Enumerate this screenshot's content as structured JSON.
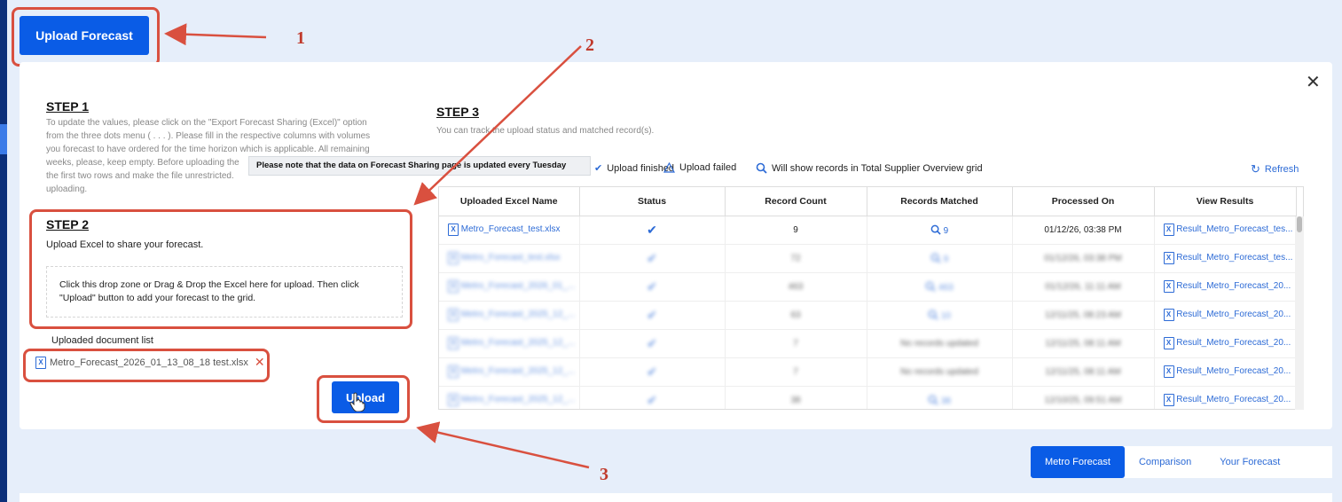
{
  "header": {
    "upload_forecast_label": "Upload Forecast"
  },
  "step1": {
    "title": "STEP 1",
    "text_lines": [
      "To update the values, please click on the \"Export Forecast Sharing (Excel)\" option",
      "from the three dots menu ( . . . ). Please fill in the respective columns with volumes",
      "you forecast to have ordered for the time horizon which is applicable. All remaining",
      "weeks, please, keep empty. Before uploading the",
      "the first two rows and make the file unrestricted.",
      "uploading."
    ]
  },
  "tooltip": {
    "text": "Please note that the data on Forecast Sharing page is updated every Tuesday"
  },
  "step2": {
    "title": "STEP 2",
    "subtitle": "Upload Excel to share your forecast.",
    "dropzone_line1": "Click this drop zone or Drag & Drop the Excel here for upload. Then click",
    "dropzone_line2": "\"Upload\" button to add your forecast to the grid."
  },
  "doclist": {
    "label": "Uploaded document list",
    "file": "Metro_Forecast_2026_01_13_08_18 test.xlsx",
    "remove_icon": "✕"
  },
  "upload_button": {
    "label": "Upload"
  },
  "step3": {
    "title": "STEP 3",
    "subtitle": "You can track the upload status and matched record(s).",
    "legend": {
      "finished": "Upload finished",
      "failed": "Upload failed",
      "records": "Will show records in Total Supplier Overview grid"
    },
    "refresh_label": "Refresh"
  },
  "grid": {
    "columns": [
      "Uploaded Excel Name",
      "Status",
      "Record Count",
      "Records Matched",
      "Processed On",
      "View Results"
    ],
    "rows": [
      {
        "file": "Metro_Forecast_test.xlsx",
        "count": "9",
        "matched": "9",
        "processed": "01/12/26, 03:38 PM",
        "result": "Result_Metro_Forecast_tes...",
        "blurred": false
      },
      {
        "file": "Metro_Forecast_test.xlsx",
        "count": "72",
        "matched": "9",
        "processed": "01/12/26, 03:38 PM",
        "result": "Result_Metro_Forecast_tes...",
        "blurred": true
      },
      {
        "file": "Metro_Forecast_2026_01_...",
        "count": "463",
        "matched": "463",
        "processed": "01/12/26, 11:11 AM",
        "result": "Result_Metro_Forecast_20...",
        "blurred": true
      },
      {
        "file": "Metro_Forecast_2025_12_...",
        "count": "63",
        "matched": "10",
        "processed": "12/11/25, 08:23 AM",
        "result": "Result_Metro_Forecast_20...",
        "blurred": true
      },
      {
        "file": "Metro_Forecast_2025_12_...",
        "count": "7",
        "matched": "No records updated",
        "processed": "12/11/25, 08:11 AM",
        "result": "Result_Metro_Forecast_20...",
        "blurred": true
      },
      {
        "file": "Metro_Forecast_2025_12_...",
        "count": "7",
        "matched": "No records updated",
        "processed": "12/11/25, 08:11 AM",
        "result": "Result_Metro_Forecast_20...",
        "blurred": true
      },
      {
        "file": "Metro_Forecast_2025_12_...",
        "count": "38",
        "matched": "38",
        "processed": "12/10/25, 09:51 AM",
        "result": "Result_Metro_Forecast_20...",
        "blurred": true
      }
    ]
  },
  "tabs": [
    "Metro Forecast",
    "Comparison",
    "Your Forecast"
  ],
  "annotations": [
    "1",
    "2",
    "3"
  ],
  "colors": {
    "primary": "#0a5ce6",
    "annotation": "#d9503f",
    "link": "#2d6bd6"
  }
}
